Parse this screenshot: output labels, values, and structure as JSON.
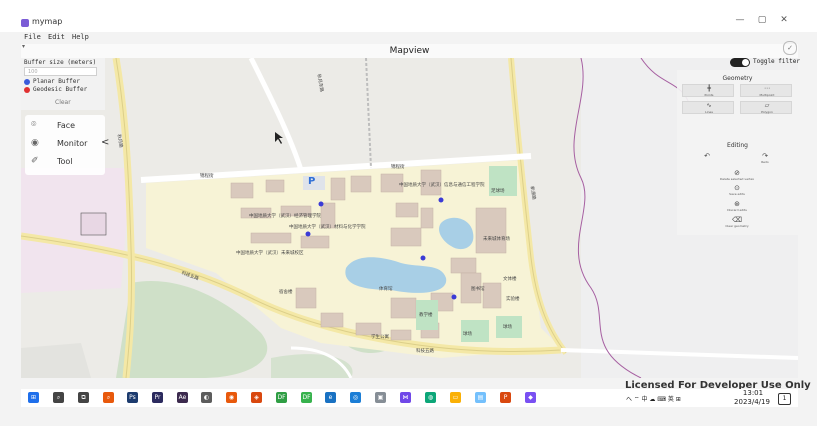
{
  "window": {
    "app_title": "mymap",
    "minimize": "—",
    "maximize": "▢",
    "close": "✕"
  },
  "menu": {
    "file": "File",
    "edit": "Edit",
    "help": "Help",
    "arrow": "▾"
  },
  "view": {
    "title": "Mapview",
    "check": "✓"
  },
  "buffer_panel": {
    "title": "Buffer size (meters)",
    "input_placeholder": "100",
    "options": [
      {
        "label": "Planar Buffer",
        "color": "#3b5bdb"
      },
      {
        "label": "Geodesic Buffer",
        "color": "#e03131"
      }
    ],
    "clear": "Clear"
  },
  "side_menu": {
    "items": [
      {
        "label": "Face",
        "icon": "face-icon",
        "glyph": "⌾"
      },
      {
        "label": "Monitor",
        "icon": "monitor-icon",
        "glyph": "◉"
      },
      {
        "label": "Tool",
        "icon": "tool-icon",
        "glyph": "✐"
      }
    ],
    "collapse_glyph": "<"
  },
  "toggle": {
    "label": "Toggle filter",
    "on": true
  },
  "geometry": {
    "title": "Geometry",
    "buttons": [
      {
        "glyph": "╋",
        "label": "Points"
      },
      {
        "glyph": "⋯",
        "label": "Multipoint"
      },
      {
        "glyph": "∿",
        "label": "Lines"
      },
      {
        "glyph": "▱",
        "label": "Polygon"
      }
    ],
    "editing_title": "Editing",
    "edit_items": [
      {
        "glyph": "↶",
        "label": ""
      },
      {
        "glyph": "↷",
        "label": "Redo"
      },
      {
        "glyph": "⊘",
        "label": "Delete selected vertex"
      },
      {
        "glyph": "⊙",
        "label": "Save edits"
      },
      {
        "glyph": "⊛",
        "label": "Discard edits"
      },
      {
        "glyph": "⌫",
        "label": "Clear geometry"
      }
    ]
  },
  "map_labels": {
    "road1": "锦程街",
    "road2": "锦程街",
    "road3": "秋月东路",
    "road4": "秋月路",
    "road5": "新源路",
    "road6": "科技五路",
    "poi1": "中国地质大学（武汉）信息与通信工程学院",
    "poi2": "中国地质大学（武汉）经济管理学院",
    "poi3": "中国地质大学（武汉）材料与化学学院",
    "poi4": "中国地质大学（武汉）未来城校区",
    "poi5": "未来城体育场",
    "poi6": "体育馆",
    "poi7": "球场",
    "poi8": "文体楼",
    "poi9": "足球场",
    "poi10": "图书馆",
    "poi11": "实验楼",
    "poi12": "宿舍楼",
    "poi13": "教学楼",
    "poi14": "学生公寓",
    "parking": "P"
  },
  "watermark": "Licensed For Developer Use Only",
  "taskbar": {
    "tray": "へ ⌔ 中 ☁ ⌨ 英 ⊞",
    "time": "13:01",
    "date": "2023/4/19",
    "notif": "1",
    "apps": [
      {
        "icon": "start-icon",
        "color": "#1f6feb",
        "glyph": "⊞"
      },
      {
        "icon": "search-icon",
        "color": "#444444",
        "glyph": "⌕"
      },
      {
        "icon": "taskview-icon",
        "color": "#444444",
        "glyph": "⧉"
      },
      {
        "icon": "search-app-icon",
        "color": "#e8590c",
        "glyph": "⌕"
      },
      {
        "icon": "photoshop-icon",
        "color": "#1c3b6e",
        "glyph": "Ps"
      },
      {
        "icon": "premiere-icon",
        "color": "#2b2a5e",
        "glyph": "Pr"
      },
      {
        "icon": "aftereffects-icon",
        "color": "#3c2a4e",
        "glyph": "Ae"
      },
      {
        "icon": "app1-icon",
        "color": "#5c5c5c",
        "glyph": "◐"
      },
      {
        "icon": "blender-icon",
        "color": "#e8590c",
        "glyph": "◉"
      },
      {
        "icon": "app2-icon",
        "color": "#d9480f",
        "glyph": "◈"
      },
      {
        "icon": "app3-icon",
        "color": "#2f9e44",
        "glyph": "DF"
      },
      {
        "icon": "app4-icon",
        "color": "#37b24d",
        "glyph": "DF"
      },
      {
        "icon": "edge-icon",
        "color": "#1971c2",
        "glyph": "e"
      },
      {
        "icon": "app5-icon",
        "color": "#1c7ed6",
        "glyph": "◎"
      },
      {
        "icon": "app6-icon",
        "color": "#868e96",
        "glyph": "▣"
      },
      {
        "icon": "vs-icon",
        "color": "#7048e8",
        "glyph": "⋈"
      },
      {
        "icon": "browser-icon",
        "color": "#0ca678",
        "glyph": "◍"
      },
      {
        "icon": "explorer-icon",
        "color": "#fab005",
        "glyph": "▭"
      },
      {
        "icon": "app7-icon",
        "color": "#74c0fc",
        "glyph": "▤"
      },
      {
        "icon": "powerpoint-icon",
        "color": "#d9480f",
        "glyph": "P"
      },
      {
        "icon": "mymap-icon",
        "color": "#7950f2",
        "glyph": "◆"
      }
    ]
  }
}
